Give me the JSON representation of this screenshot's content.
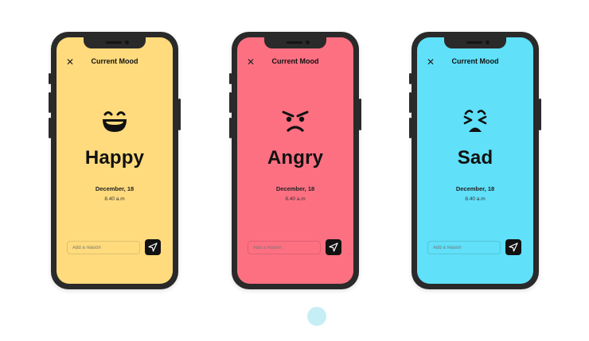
{
  "colors": {
    "happy_bg": "#ffdb7d",
    "angry_bg": "#fd7082",
    "sad_bg": "#60e0f9",
    "frame": "#2a2a2a",
    "page_dot": "#c6eef5"
  },
  "screens": [
    {
      "title": "Current Mood",
      "close_icon": "close-icon",
      "emoji_icon": "grinning-face-icon",
      "mood": "Happy",
      "date": "December, 18",
      "time": "8.40 a.m",
      "reason_placeholder": "Add a reason",
      "send_icon": "send-icon"
    },
    {
      "title": "Current Mood",
      "close_icon": "close-icon",
      "emoji_icon": "angry-face-icon",
      "mood": "Angry",
      "date": "December, 18",
      "time": "8.40 a.m",
      "reason_placeholder": "Add a reason",
      "send_icon": "send-icon"
    },
    {
      "title": "Current Mood",
      "close_icon": "close-icon",
      "emoji_icon": "crying-face-icon",
      "mood": "Sad",
      "date": "December, 18",
      "time": "8.40 a.m",
      "reason_placeholder": "Add a reason",
      "send_icon": "send-icon"
    }
  ]
}
